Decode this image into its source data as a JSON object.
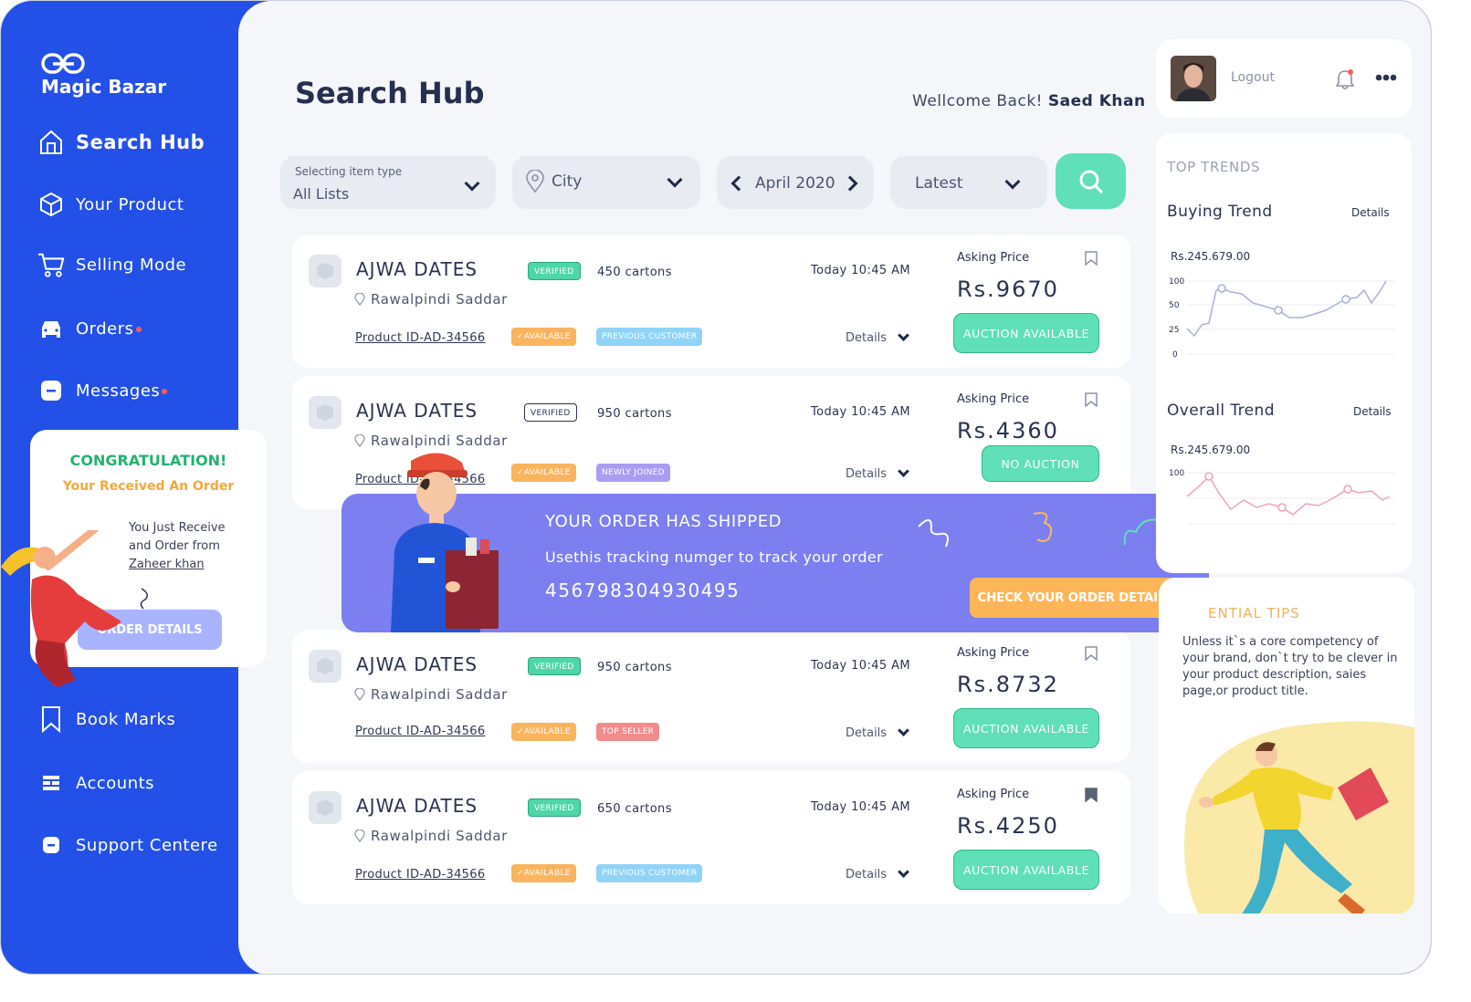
{
  "brand": {
    "name": "Magic Bazar"
  },
  "sidebar": {
    "items": [
      {
        "label": "Search Hub",
        "icon": "home-icon"
      },
      {
        "label": "Your Product",
        "icon": "box-icon"
      },
      {
        "label": "Selling Mode",
        "icon": "cart-icon"
      },
      {
        "label": "Orders",
        "icon": "car-icon",
        "dot": true
      },
      {
        "label": "Messages",
        "icon": "message-icon",
        "dot": true
      },
      {
        "label": "Book Marks",
        "icon": "bookmark-icon"
      },
      {
        "label": "Accounts",
        "icon": "accounts-icon"
      },
      {
        "label": "Support Centere",
        "icon": "support-icon"
      }
    ]
  },
  "congrats": {
    "title": "CONGRATULATION!",
    "subtitle": "Your Received An Order",
    "line1": "You Just Receive",
    "line2": "and Order from",
    "from": "Zaheer khan",
    "button": "ORDER DETAILS"
  },
  "header": {
    "title": "Search Hub",
    "welcome": "Wellcome Back!",
    "user": "Saed Khan"
  },
  "filters": {
    "item_type_label": "Selecting item type",
    "item_type_value": "All Lists",
    "city": "City",
    "month": "April 2020",
    "sort": "Latest"
  },
  "products": [
    {
      "name": "AJWA DATES",
      "location": "Rawalpindi Saddar",
      "product_id": "Product ID-AD-34566",
      "verified": "VERIFIED",
      "quantity": "450 cartons",
      "time": "Today 10:45 AM",
      "availability": "✓AVAILABLE",
      "tag": "PREVIOUS CUSTOMER",
      "details": "Details",
      "asking_label": "Asking Price",
      "price": "Rs.9670",
      "action": "AUCTION AVAILABLE"
    },
    {
      "name": "AJWA DATES",
      "location": "Rawalpindi Saddar",
      "product_id": "Product ID-AD-34566",
      "verified": "VERIFIED",
      "quantity": "950 cartons",
      "time": "Today 10:45 AM",
      "availability": "✓AVAILABLE",
      "tag": "NEWLY JOINED",
      "details": "Details",
      "asking_label": "Asking Price",
      "price": "Rs.4360",
      "action": "NO AUCTION"
    },
    {
      "name": "AJWA DATES",
      "location": "Rawalpindi Saddar",
      "product_id": "Product ID-AD-34566",
      "verified": "VERIFIED",
      "quantity": "950 cartons",
      "time": "Today 10:45 AM",
      "availability": "✓AVAILABLE",
      "tag": "TOP SELLER",
      "details": "Details",
      "asking_label": "Asking Price",
      "price": "Rs.8732",
      "action": "AUCTION AVAILABLE"
    },
    {
      "name": "AJWA DATES",
      "location": "Rawalpindi Saddar",
      "product_id": "Product ID-AD-34566",
      "verified": "VERIFIED",
      "quantity": "650 cartons",
      "time": "Today 10:45 AM",
      "availability": "✓AVAILABLE",
      "tag": "PREVIOUS CUSTOMER",
      "details": "Details",
      "asking_label": "Asking Price",
      "price": "Rs.4250",
      "action": "AUCTION AVAILABLE"
    }
  ],
  "shipped": {
    "title": "YOUR ORDER HAS SHIPPED",
    "subtitle": "Usethis  tracking numger to track your order",
    "tracking": "456798304930495",
    "button": "CHECK YOUR ORDER DETAILS"
  },
  "profile": {
    "logout": "Logout"
  },
  "trends": {
    "title": "TOP TRENDS",
    "buying": {
      "label": "Buying Trend",
      "details": "Details",
      "amount": "Rs.245.679.00",
      "ticks": [
        "100",
        "50",
        "25",
        "0"
      ]
    },
    "overall": {
      "label": "Overall Trend",
      "details": "Details",
      "amount": "Rs.245.679.00",
      "ticks": [
        "100"
      ]
    }
  },
  "tips": {
    "title": "ENTIAL TIPS",
    "text": "Unless it`s a core competency of your brand, don`t try to be clever in your product description, saies page,or product title."
  },
  "colors": {
    "sidebar": "#2350e6",
    "accent_green": "#5fe0b7",
    "shipped_banner": "#7b7ff0",
    "orange": "#ffb658"
  }
}
